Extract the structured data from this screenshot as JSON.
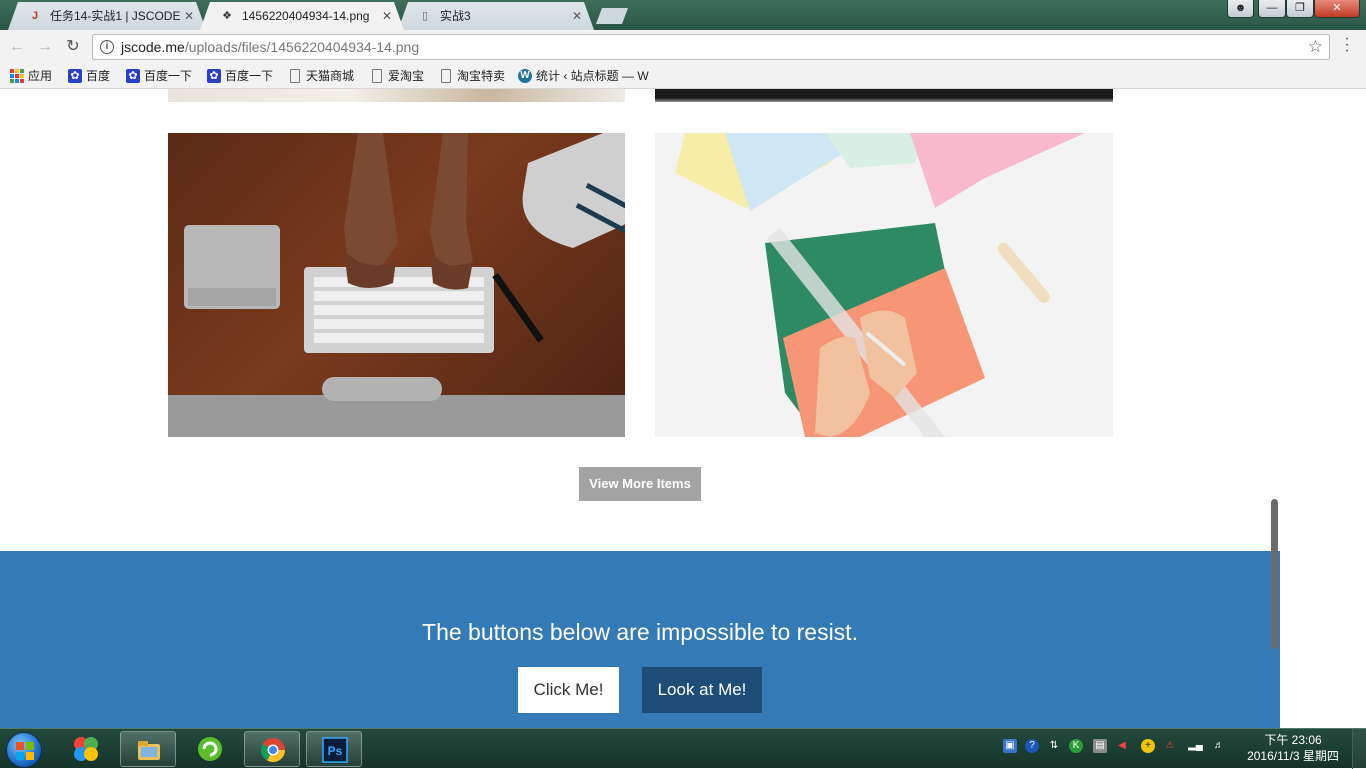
{
  "browser": {
    "tabs": [
      {
        "label": "任务14-实战1 | JSCODE",
        "favicon": "jscode-favicon"
      },
      {
        "label": "1456220404934-14.png",
        "favicon": "image-favicon"
      },
      {
        "label": "实战3",
        "favicon": "page-favicon"
      }
    ],
    "active_tab": 1,
    "close_glyph": "✕",
    "address": {
      "domain": "jscode.me",
      "path": "/uploads/files/1456220404934-14.png"
    },
    "bookmarks": [
      {
        "label": "应用",
        "icon": "apps-grid-icon"
      },
      {
        "label": "百度",
        "icon": "baidu-paw-icon"
      },
      {
        "label": "百度一下",
        "icon": "baidu-paw-icon"
      },
      {
        "label": "百度一下",
        "icon": "baidu-paw-icon"
      },
      {
        "label": "天猫商城",
        "icon": "page-icon"
      },
      {
        "label": "爱淘宝",
        "icon": "page-icon"
      },
      {
        "label": "淘宝特卖",
        "icon": "page-icon"
      },
      {
        "label": "统计 ‹ 站点标题 — W",
        "icon": "wordpress-icon"
      }
    ]
  },
  "page": {
    "view_more_label": "View More Items",
    "cta_text": "The buttons below are impossible to resist.",
    "click_me_label": "Click Me!",
    "look_at_me_label": "Look at Me!",
    "colors": {
      "cta_background": "#337ab7",
      "look_button": "#1e4d78",
      "view_more": "#a3a3a3"
    }
  },
  "taskbar": {
    "pinned_apps": [
      "windows-explorer-icon",
      "chrome-icon",
      "photoshop-icon"
    ],
    "clock_time": "下午 23:06",
    "clock_date": "2016/11/3 星期四"
  }
}
